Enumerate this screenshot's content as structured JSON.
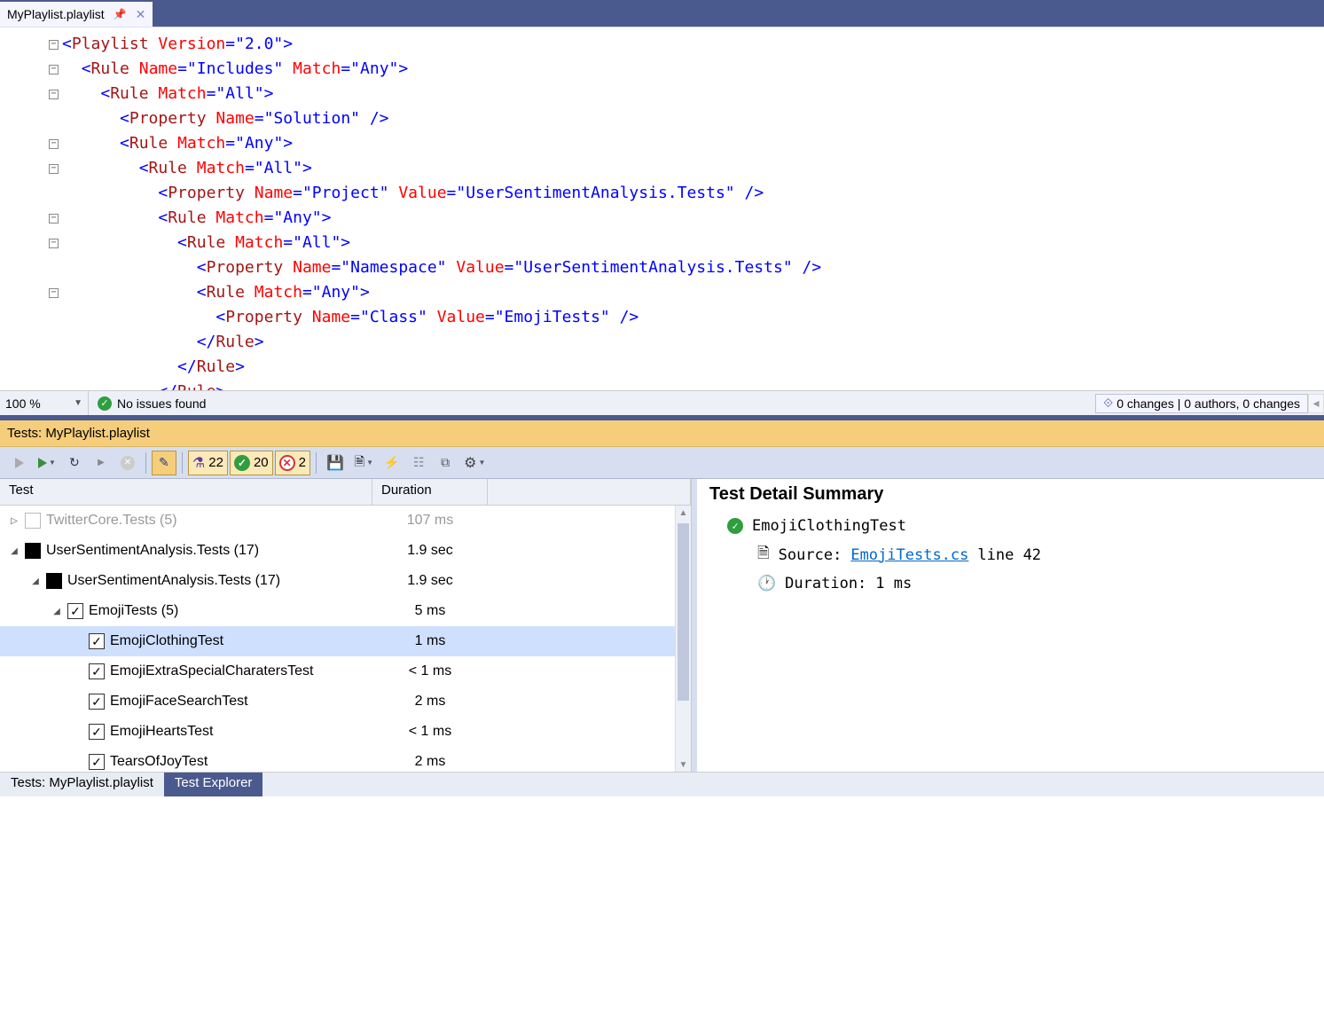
{
  "tab": {
    "title": "MyPlaylist.playlist"
  },
  "code": {
    "lines": [
      {
        "indent": 0,
        "html": "<span class='t-blue'>&lt;</span><span class='t-brown'>Playlist</span> <span class='t-red'>Version</span><span class='t-blue'>=\"2.0\"&gt;</span>"
      },
      {
        "indent": 1,
        "html": "<span class='t-blue'>&lt;</span><span class='t-brown'>Rule</span> <span class='t-red'>Name</span><span class='t-blue'>=\"Includes\"</span> <span class='t-red'>Match</span><span class='t-blue'>=\"Any\"&gt;</span>"
      },
      {
        "indent": 2,
        "html": "<span class='t-blue'>&lt;</span><span class='t-brown'>Rule</span> <span class='t-red'>Match</span><span class='t-blue'>=\"All\"&gt;</span>"
      },
      {
        "indent": 3,
        "html": "<span class='t-blue'>&lt;</span><span class='t-brown'>Property</span> <span class='t-red'>Name</span><span class='t-blue'>=\"Solution\" /&gt;</span>"
      },
      {
        "indent": 3,
        "html": "<span class='t-blue'>&lt;</span><span class='t-brown'>Rule</span> <span class='t-red'>Match</span><span class='t-blue'>=\"Any\"&gt;</span>"
      },
      {
        "indent": 4,
        "html": "<span class='t-blue'>&lt;</span><span class='t-brown'>Rule</span> <span class='t-red'>Match</span><span class='t-blue'>=\"All\"&gt;</span>"
      },
      {
        "indent": 5,
        "html": "<span class='t-blue'>&lt;</span><span class='t-brown'>Property</span> <span class='t-red'>Name</span><span class='t-blue'>=\"Project\"</span> <span class='t-red'>Value</span><span class='t-blue'>=\"UserSentimentAnalysis.Tests\" /&gt;</span>"
      },
      {
        "indent": 5,
        "html": "<span class='t-blue'>&lt;</span><span class='t-brown'>Rule</span> <span class='t-red'>Match</span><span class='t-blue'>=\"Any\"&gt;</span>"
      },
      {
        "indent": 6,
        "html": "<span class='t-blue'>&lt;</span><span class='t-brown'>Rule</span> <span class='t-red'>Match</span><span class='t-blue'>=\"All\"&gt;</span>"
      },
      {
        "indent": 7,
        "html": "<span class='t-blue'>&lt;</span><span class='t-brown'>Property</span> <span class='t-red'>Name</span><span class='t-blue'>=\"Namespace\"</span> <span class='t-red'>Value</span><span class='t-blue'>=\"UserSentimentAnalysis.Tests\" /&gt;</span>"
      },
      {
        "indent": 7,
        "html": "<span class='t-blue'>&lt;</span><span class='t-brown'>Rule</span> <span class='t-red'>Match</span><span class='t-blue'>=\"Any\"&gt;</span>"
      },
      {
        "indent": 8,
        "html": "<span class='t-blue'>&lt;</span><span class='t-brown'>Property</span> <span class='t-red'>Name</span><span class='t-blue'>=\"Class\"</span> <span class='t-red'>Value</span><span class='t-blue'>=\"EmojiTests\" /&gt;</span>"
      },
      {
        "indent": 7,
        "html": "<span class='t-blue'>&lt;/</span><span class='t-brown'>Rule</span><span class='t-blue'>&gt;</span>"
      },
      {
        "indent": 6,
        "html": "<span class='t-blue'>&lt;/</span><span class='t-brown'>Rule</span><span class='t-blue'>&gt;</span>"
      },
      {
        "indent": 5,
        "html": "<span class='t-blue'>&lt;/</span><span class='t-brown'>Rule</span><span class='t-blue'>&gt;</span>"
      }
    ]
  },
  "status": {
    "zoom": "100 %",
    "issues": "No issues found",
    "changes": "0 changes | 0 authors, 0 changes"
  },
  "testsHeader": "Tests: MyPlaylist.playlist",
  "toolbar": {
    "total": "22",
    "passed": "20",
    "failed": "2"
  },
  "columns": {
    "test": "Test",
    "duration": "Duration"
  },
  "tree": [
    {
      "indent": 0,
      "exp": "▷",
      "chk": "empty-dim",
      "label": "TwitterCore.Tests  (5)",
      "dur": "107 ms",
      "gray": true
    },
    {
      "indent": 0,
      "exp": "◢",
      "chk": "filled",
      "label": "UserSentimentAnalysis.Tests  (17)",
      "dur": "1.9 sec"
    },
    {
      "indent": 1,
      "exp": "◢",
      "chk": "filled",
      "label": "UserSentimentAnalysis.Tests  (17)",
      "dur": "1.9 sec"
    },
    {
      "indent": 2,
      "exp": "◢",
      "chk": "check",
      "label": "EmojiTests  (5)",
      "dur": "5 ms"
    },
    {
      "indent": 3,
      "exp": "",
      "chk": "check",
      "label": "EmojiClothingTest",
      "dur": "1 ms",
      "sel": true
    },
    {
      "indent": 3,
      "exp": "",
      "chk": "check",
      "label": "EmojiExtraSpecialCharatersTest",
      "dur": "< 1 ms"
    },
    {
      "indent": 3,
      "exp": "",
      "chk": "check",
      "label": "EmojiFaceSearchTest",
      "dur": "2 ms"
    },
    {
      "indent": 3,
      "exp": "",
      "chk": "check",
      "label": "EmojiHeartsTest",
      "dur": "< 1 ms"
    },
    {
      "indent": 3,
      "exp": "",
      "chk": "check",
      "label": "TearsOfJoyTest",
      "dur": "2 ms"
    }
  ],
  "detail": {
    "title": "Test Detail Summary",
    "name": "EmojiClothingTest",
    "sourceLabel": "Source:",
    "sourceFile": "EmojiTests.cs",
    "sourceLine": "line 42",
    "durationLabel": "Duration:",
    "durationValue": "1 ms"
  },
  "bottomTabs": {
    "tab1": "Tests: MyPlaylist.playlist",
    "tab2": "Test Explorer"
  }
}
